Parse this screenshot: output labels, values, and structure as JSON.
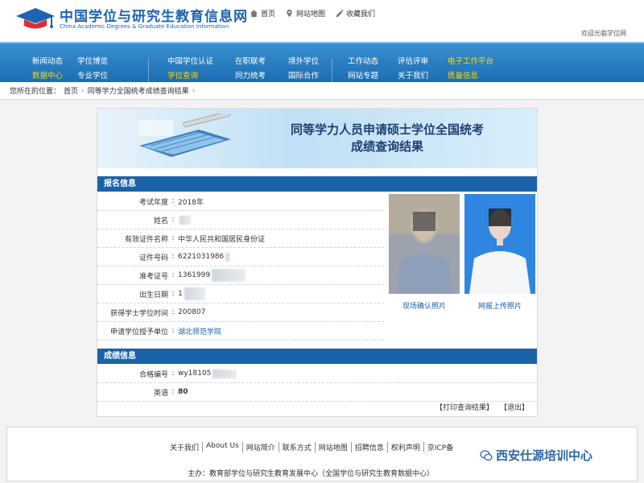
{
  "header": {
    "title": "中国学位与研究生教育信息网",
    "subtitle": "China Academic Degrees & Graduate Education Information",
    "links": [
      {
        "label": "首页",
        "icon": "home-icon"
      },
      {
        "label": "网站地图",
        "icon": "location-pin-icon"
      },
      {
        "label": "收藏我们",
        "icon": "bookmark-icon"
      }
    ],
    "welcome": "欢迎光临学位网"
  },
  "nav": {
    "columns": [
      [
        "新闻动态",
        "数据中心"
      ],
      [
        "学位博览",
        "专业学位"
      ],
      [
        "中国学位认证",
        "学位查询"
      ],
      [
        "在职联考",
        "同力统考"
      ],
      [
        "境外学位",
        "国际合作"
      ],
      [
        "工作动态",
        "网站专题"
      ],
      [
        "评估评审",
        "关于我们"
      ],
      [
        "电子工作平台",
        "质量信息"
      ]
    ]
  },
  "breadcrumb": {
    "prefix": "您所在的位置：",
    "home": "首页",
    "current": "同等学力全国统考成绩查询结果"
  },
  "banner": {
    "title_line1": "同等学力人员申请硕士学位全国统考",
    "title_line2": "成绩查询结果"
  },
  "registration": {
    "heading": "报名信息",
    "rows": [
      {
        "label": "考试年度",
        "value": "2018年"
      },
      {
        "label": "姓名",
        "value": ""
      },
      {
        "label": "有效证件名称",
        "value": "中华人民共和国居民身份证"
      },
      {
        "label": "证件号码",
        "value": "6221031986"
      },
      {
        "label": "准考证号",
        "value": "1361999"
      },
      {
        "label": "出生日期",
        "value": "1"
      },
      {
        "label": "获得学士学位时间",
        "value": "200807"
      },
      {
        "label": "申请学位授予单位",
        "value": "湖北师范学院"
      }
    ],
    "photos": [
      {
        "caption": "现场确认照片"
      },
      {
        "caption": "网报上传照片"
      }
    ]
  },
  "scores": {
    "heading": "成绩信息",
    "rows": [
      {
        "label": "合格编号",
        "value": "wy18105"
      },
      {
        "label": "英语",
        "value": "80"
      }
    ],
    "actions": [
      "【打印查询结果】",
      "【退出】"
    ]
  },
  "footer": {
    "links": [
      "关于我们",
      "About Us",
      "网站简介",
      "联系方式",
      "网站地图",
      "招聘信息",
      "权利声明",
      "京ICP备"
    ],
    "host": "主办：教育部学位与研究生教育发展中心（全国学位与研究生教育数据中心）"
  },
  "watermark": "西安仕源培训中心",
  "colors": {
    "brand_blue": "#1d64b1",
    "nav_highlight": "#ffd800",
    "section_bar": "#1b63a8"
  }
}
